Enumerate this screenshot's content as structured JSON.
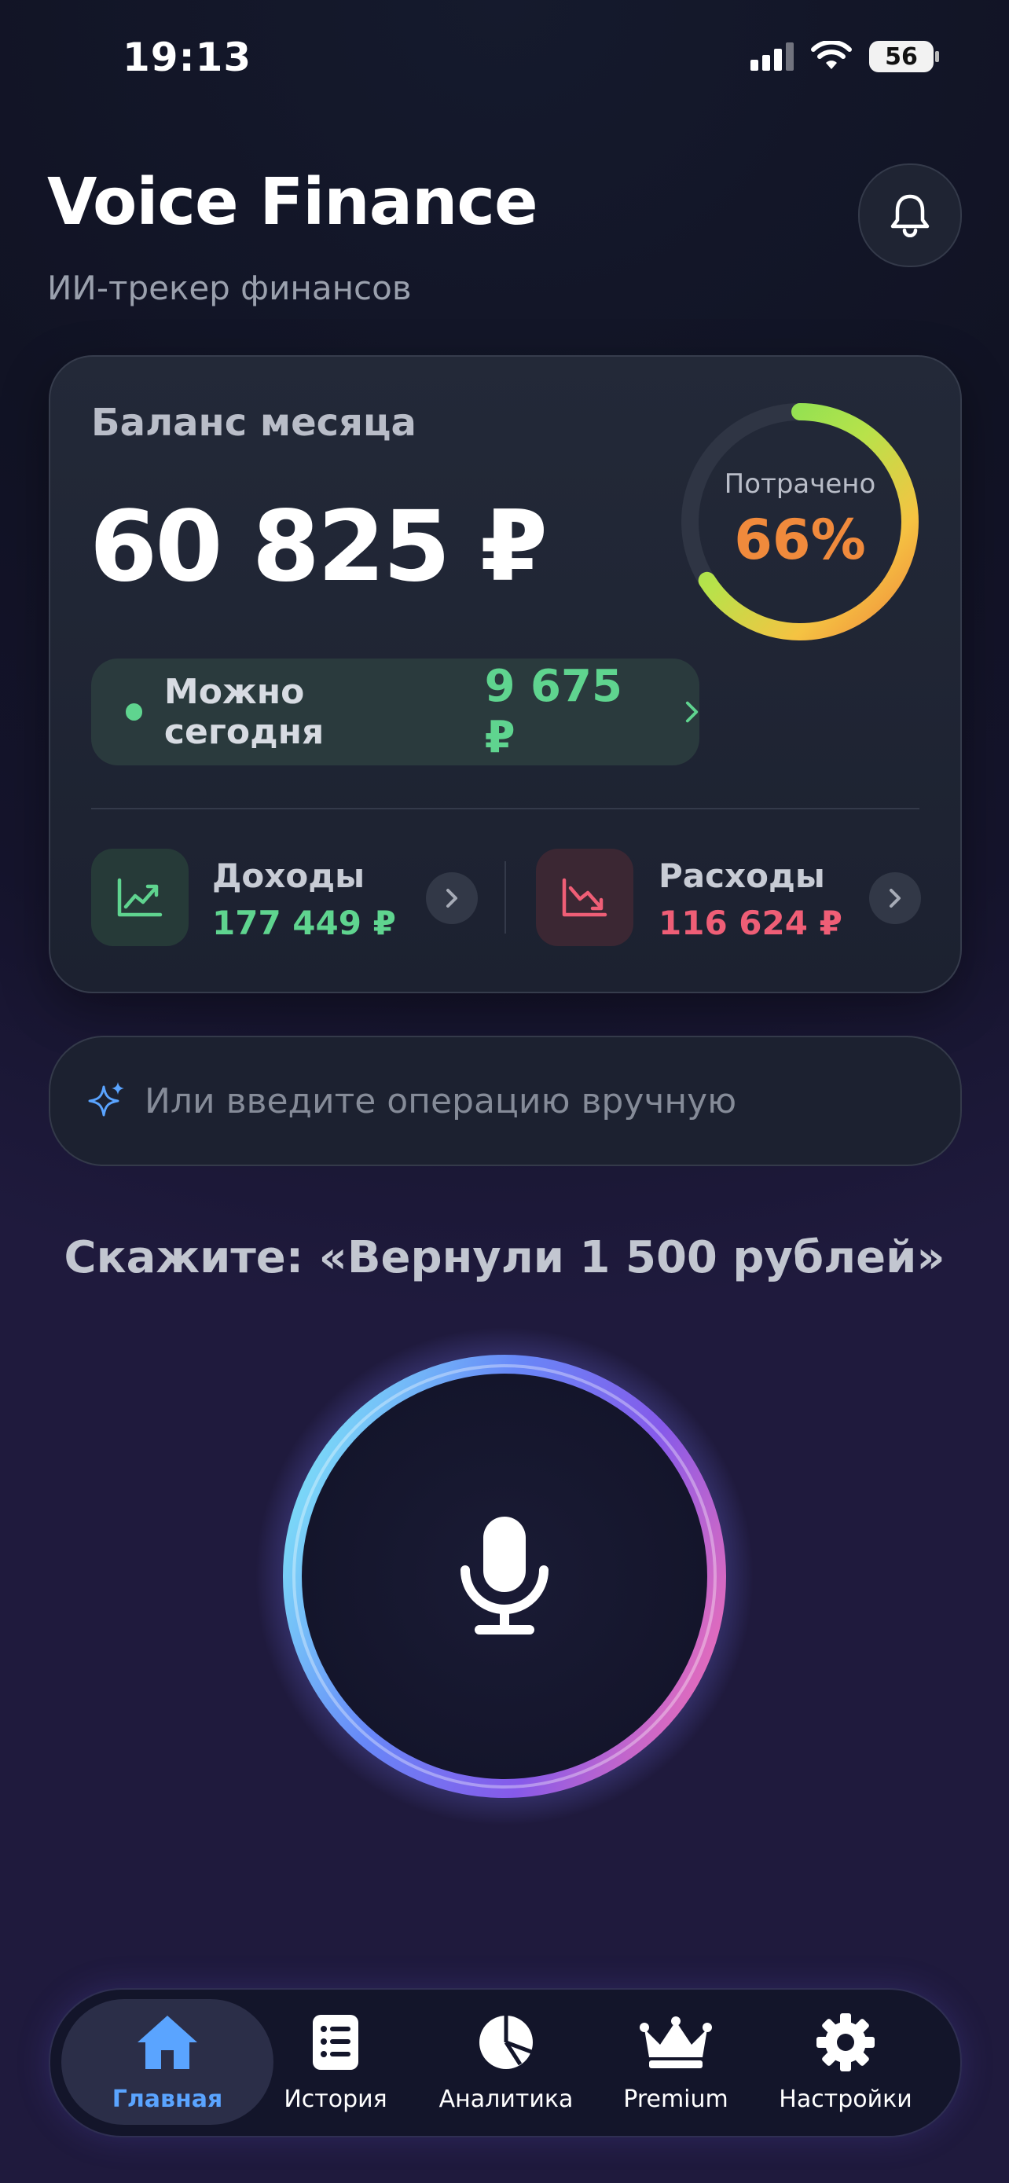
{
  "status_bar": {
    "time": "19:13",
    "battery": "56"
  },
  "header": {
    "title": "Voice Finance",
    "subtitle": "ИИ-трекер финансов"
  },
  "balance_card": {
    "label": "Баланс месяца",
    "amount": "60 825 ₽",
    "spent_label": "Потрачено",
    "spent_percent_text": "66%",
    "spent_fraction": 0.66,
    "today": {
      "label": "Можно сегодня",
      "value": "9 675 ₽"
    },
    "income": {
      "label": "Доходы",
      "value": "177 449 ₽"
    },
    "expenses": {
      "label": "Расходы",
      "value": "116 624 ₽"
    }
  },
  "manual_input": {
    "placeholder": "Или введите операцию вручную"
  },
  "voice_hint": "Скажите: «Вернули 1 500 рублей»",
  "tabs": [
    {
      "label": "Главная",
      "icon": "home-icon",
      "active": true
    },
    {
      "label": "История",
      "icon": "list-icon",
      "active": false
    },
    {
      "label": "Аналитика",
      "icon": "pie-chart-icon",
      "active": false
    },
    {
      "label": "Premium",
      "icon": "crown-icon",
      "active": false
    },
    {
      "label": "Настройки",
      "icon": "gear-icon",
      "active": false
    }
  ],
  "colors": {
    "income_green": "#5fd48f",
    "expense_red": "#ef5e76",
    "spent_orange": "#f08a3c",
    "active_tab_blue": "#5aa4ff"
  }
}
